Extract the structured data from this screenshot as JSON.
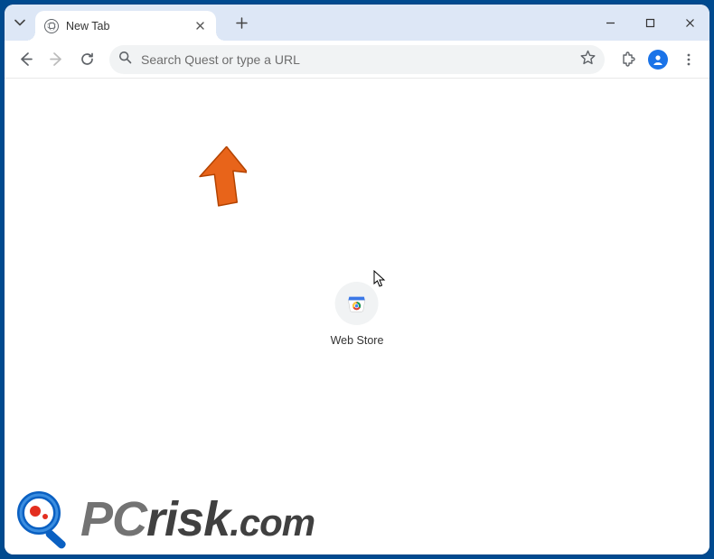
{
  "window": {
    "tab_title": "New Tab",
    "controls": {
      "minimize": "minimize",
      "maximize": "maximize",
      "close": "close"
    }
  },
  "toolbar": {
    "back": "back",
    "forward": "forward",
    "reload": "reload",
    "omnibox_placeholder": "Search Quest or type a URL",
    "bookmark": "bookmark",
    "extensions": "extensions",
    "profile": "profile",
    "menu": "menu"
  },
  "shortcuts": [
    {
      "label": "Web Store",
      "name": "web-store"
    }
  ],
  "annotation": {
    "type": "arrow",
    "color": "#e8641a"
  },
  "watermark": {
    "pc": "PC",
    "risk": "risk",
    "com": ".com"
  }
}
